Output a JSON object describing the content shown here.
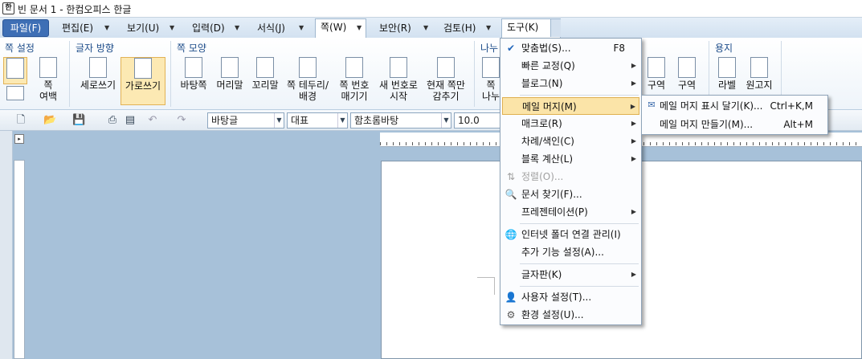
{
  "title": {
    "text": "빈 문서 1 - 한컴오피스 한글",
    "icon": "hwp-app-icon"
  },
  "tabs": [
    {
      "label": "파일(F)"
    },
    {
      "label": "편집(E)"
    },
    {
      "label": "보기(U)"
    },
    {
      "label": "입력(D)"
    },
    {
      "label": "서식(J)"
    },
    {
      "label": "쪽(W)"
    },
    {
      "label": "보안(R)"
    },
    {
      "label": "검토(H)"
    },
    {
      "label": "도구(K)"
    }
  ],
  "ribbon": {
    "groups": {
      "page_setup": "쪽 설정",
      "text_direction": "글자 방향",
      "page_shape": "쪽 모양",
      "divide": "나누",
      "paper": "용지"
    },
    "buttons": {
      "margin": "쪽\n여백",
      "vertical": "세로쓰기",
      "horizontal": "가로쓰기",
      "background": "바탕쪽",
      "header": "머리말",
      "footer": "꼬리말",
      "border": "쪽 테두리/\n배경",
      "page_number": "쪽 번호\n매기기",
      "new_number": "새 번호로\n시작",
      "hide_page": "현재 쪽만\n감추기",
      "divide_btn": "쪽\n나누",
      "section1": "구역",
      "section2": "구역",
      "label": "라벨",
      "manuscript": "원고지"
    }
  },
  "toolbar": {
    "style_combo": "바탕글",
    "lang_combo": "대표",
    "font_combo": "함초롬바탕",
    "size_combo": "10.0"
  },
  "tools_menu": [
    {
      "label": "맞춤법(S)...",
      "shortcut": "F8",
      "icon": "spellcheck-icon"
    },
    {
      "label": "빠른 교정(Q)",
      "submenu": true
    },
    {
      "label": "블로그(N)",
      "submenu": true
    },
    {
      "label": "메일 머지(M)",
      "submenu": true,
      "active": true
    },
    {
      "label": "매크로(R)",
      "submenu": true
    },
    {
      "label": "차례/색인(C)",
      "submenu": true
    },
    {
      "label": "블록 계산(L)",
      "submenu": true
    },
    {
      "label": "정렬(O)...",
      "disabled": true,
      "icon": "sort-icon"
    },
    {
      "label": "문서 찾기(F)...",
      "icon": "find-document-icon"
    },
    {
      "label": "프레젠테이션(P)",
      "submenu": true
    },
    {
      "label": "인터넷 폴더 연결 관리(I)",
      "icon": "internet-folder-icon"
    },
    {
      "label": "추가 기능 설정(A)..."
    },
    {
      "label": "글자판(K)",
      "submenu": true
    },
    {
      "label": "사용자 설정(T)...",
      "icon": "user-settings-icon"
    },
    {
      "label": "환경 설정(U)...",
      "icon": "preferences-gear-icon"
    }
  ],
  "mail_merge_submenu": [
    {
      "label": "메일 머지 표시 달기(K)...",
      "shortcut": "Ctrl+K,M",
      "icon": "mail-merge-mark-icon"
    },
    {
      "label": "메일 머지 만들기(M)...",
      "shortcut": "Alt+M"
    }
  ]
}
